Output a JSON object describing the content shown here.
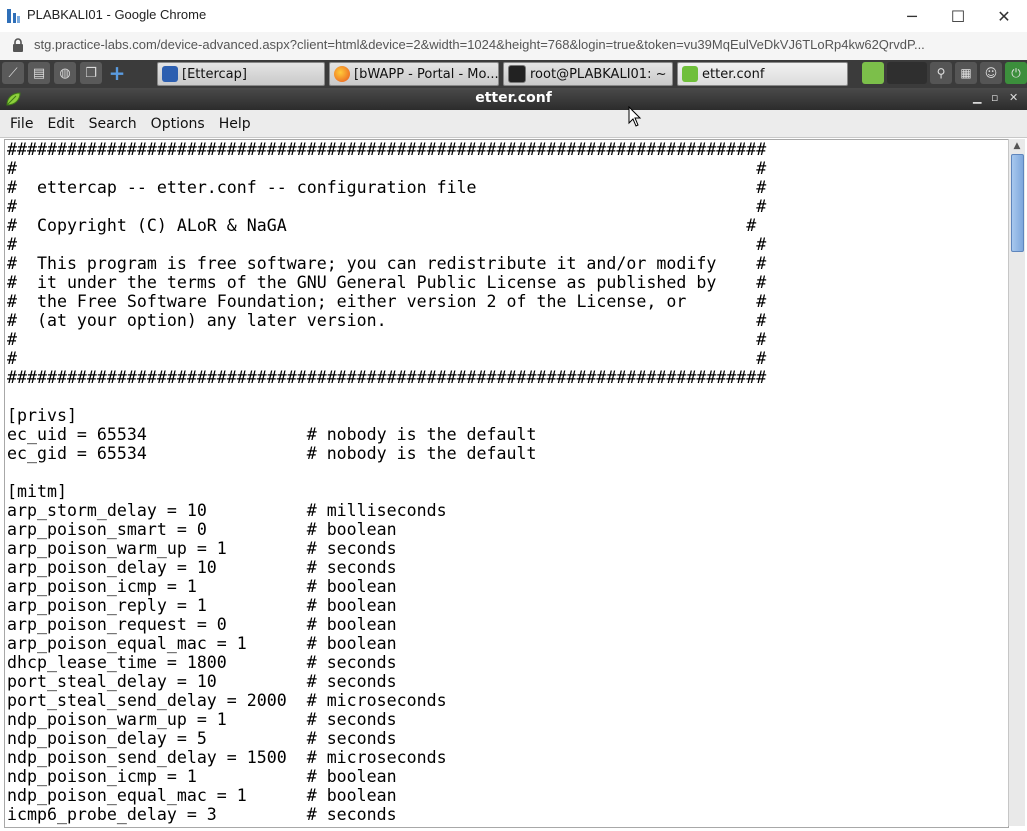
{
  "window": {
    "title": "PLABKALI01 - Google Chrome",
    "controls": {
      "minimize": "─",
      "maximize": "☐",
      "close": "✕"
    }
  },
  "address_bar": {
    "url": "stg.practice-labs.com/device-advanced.aspx?client=html&device=2&width=1024&height=768&login=true&token=vu39MqEulVeDkVJ6TLoRp4kw62QrvdP..."
  },
  "taskbar": {
    "tasks": [
      {
        "label": "[Ettercap]",
        "icon": "ettercap-icon"
      },
      {
        "label": "[bWAPP - Portal - Mo...",
        "icon": "firefox-icon"
      },
      {
        "label": "root@PLABKALI01: ~",
        "icon": "terminal-icon"
      },
      {
        "label": "etter.conf",
        "icon": "leafpad-icon"
      }
    ]
  },
  "app": {
    "title": "etter.conf",
    "controls": {
      "minimize": "▁",
      "maximize": "▫",
      "close": "✕"
    }
  },
  "menu": {
    "items": [
      "File",
      "Edit",
      "Search",
      "Options",
      "Help"
    ]
  },
  "editor": {
    "lines": [
      "############################################################################",
      "#                                                                          #",
      "#  ettercap -- etter.conf -- configuration file                            #",
      "#                                                                          #",
      "#  Copyright (C) ALoR & NaGA                                              #",
      "#                                                                          #",
      "#  This program is free software; you can redistribute it and/or modify    #",
      "#  it under the terms of the GNU General Public License as published by    #",
      "#  the Free Software Foundation; either version 2 of the License, or       #",
      "#  (at your option) any later version.                                     #",
      "#                                                                          #",
      "#                                                                          #",
      "############################################################################",
      "",
      "[privs]",
      "ec_uid = 65534                # nobody is the default",
      "ec_gid = 65534                # nobody is the default",
      "",
      "[mitm]",
      "arp_storm_delay = 10          # milliseconds",
      "arp_poison_smart = 0          # boolean",
      "arp_poison_warm_up = 1        # seconds",
      "arp_poison_delay = 10         # seconds",
      "arp_poison_icmp = 1           # boolean",
      "arp_poison_reply = 1          # boolean",
      "arp_poison_request = 0        # boolean",
      "arp_poison_equal_mac = 1      # boolean",
      "dhcp_lease_time = 1800        # seconds",
      "port_steal_delay = 10         # seconds",
      "port_steal_send_delay = 2000  # microseconds",
      "ndp_poison_warm_up = 1        # seconds",
      "ndp_poison_delay = 5          # seconds",
      "ndp_poison_send_delay = 1500  # microseconds",
      "ndp_poison_icmp = 1           # boolean",
      "ndp_poison_equal_mac = 1      # boolean",
      "icmp6_probe_delay = 3         # seconds"
    ]
  },
  "colors": {
    "taskbar_bg": "#3b3b3b",
    "app_title_bg": "#2c2c2c",
    "scroll_thumb": "#7ea7dc"
  }
}
